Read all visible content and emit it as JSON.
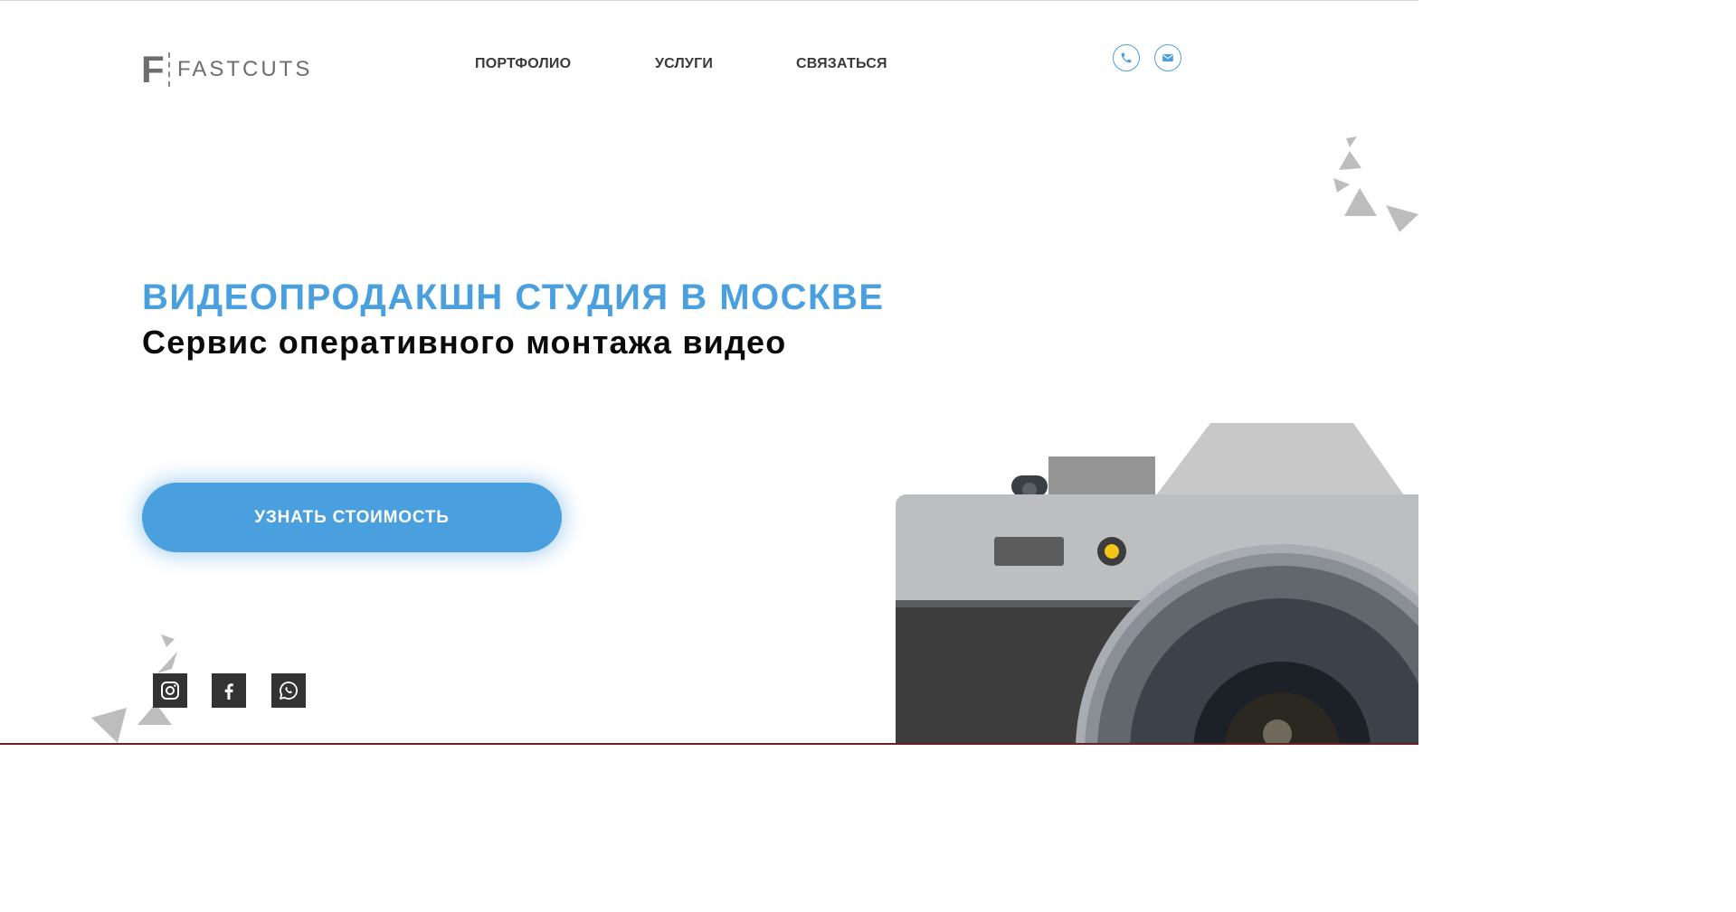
{
  "brand": {
    "logo_letter": "F",
    "logo_text": "FASTCUTS"
  },
  "nav": {
    "portfolio": "ПОРТФОЛИО",
    "services": "УСЛУГИ",
    "contact": "СВЯЗАТЬСЯ"
  },
  "header_icons": [
    "phone-icon",
    "mail-icon"
  ],
  "hero": {
    "title": "ВИДЕОПРОДАКШН СТУДИЯ В МОСКВЕ",
    "subtitle": "Сервис оперативного монтажа видео",
    "cta_label": "УЗНАТЬ СТОИМОСТЬ"
  },
  "social": [
    "instagram-icon",
    "facebook-icon",
    "whatsapp-icon"
  ],
  "colors": {
    "accent": "#4aa0df",
    "text_dark": "#0a0a0a",
    "nav_text": "#3a3a3a",
    "social_bg": "#333333",
    "decor_gray": "#bdbdbd"
  }
}
